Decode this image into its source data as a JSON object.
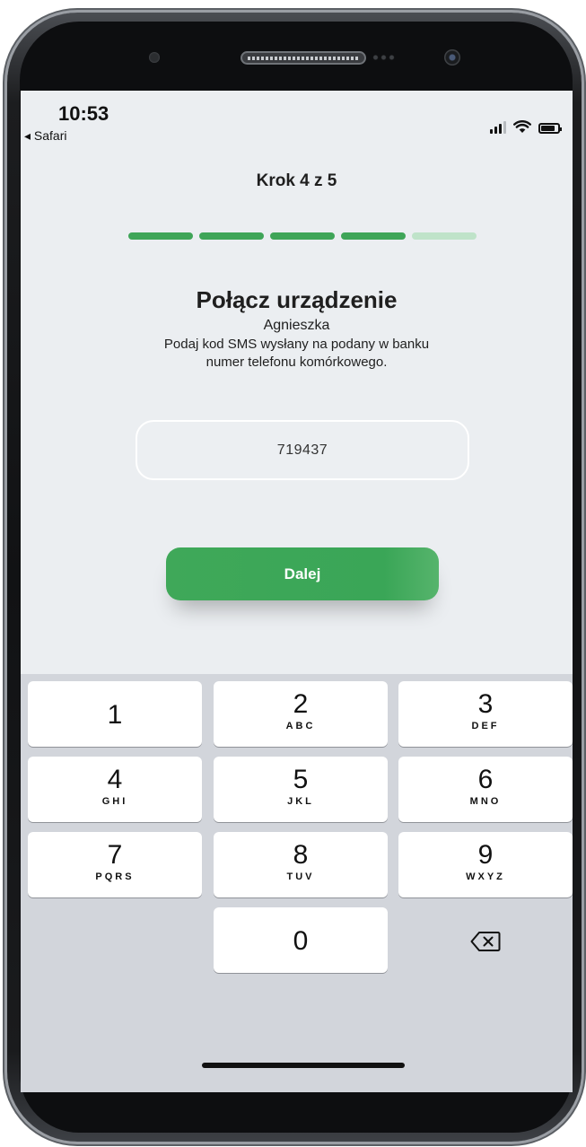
{
  "status_bar": {
    "time": "10:53",
    "back_app": "◂ Safari"
  },
  "wizard": {
    "step_label": "Krok 4 z 5",
    "progress": {
      "current": 4,
      "total": 5
    },
    "title": "Połącz urządzenie",
    "user_name": "Agnieszka",
    "hint_line1": "Podaj kod SMS wysłany na podany w banku",
    "hint_line2": "numer telefonu komórkowego.",
    "code_value": "719437",
    "next_label": "Dalej"
  },
  "keypad": {
    "keys": [
      {
        "digit": "1",
        "letters": ""
      },
      {
        "digit": "2",
        "letters": "ABC"
      },
      {
        "digit": "3",
        "letters": "DEF"
      },
      {
        "digit": "4",
        "letters": "GHI"
      },
      {
        "digit": "5",
        "letters": "JKL"
      },
      {
        "digit": "6",
        "letters": "MNO"
      },
      {
        "digit": "7",
        "letters": "PQRS"
      },
      {
        "digit": "8",
        "letters": "TUV"
      },
      {
        "digit": "9",
        "letters": "WXYZ"
      },
      {
        "digit": "0",
        "letters": ""
      }
    ],
    "delete_icon": "backspace-icon"
  },
  "colors": {
    "accent_green": "#3fa558",
    "progress_inactive": "#bfe3c9",
    "screen_bg": "#ebeef1",
    "keyboard_bg": "#d2d5db"
  }
}
